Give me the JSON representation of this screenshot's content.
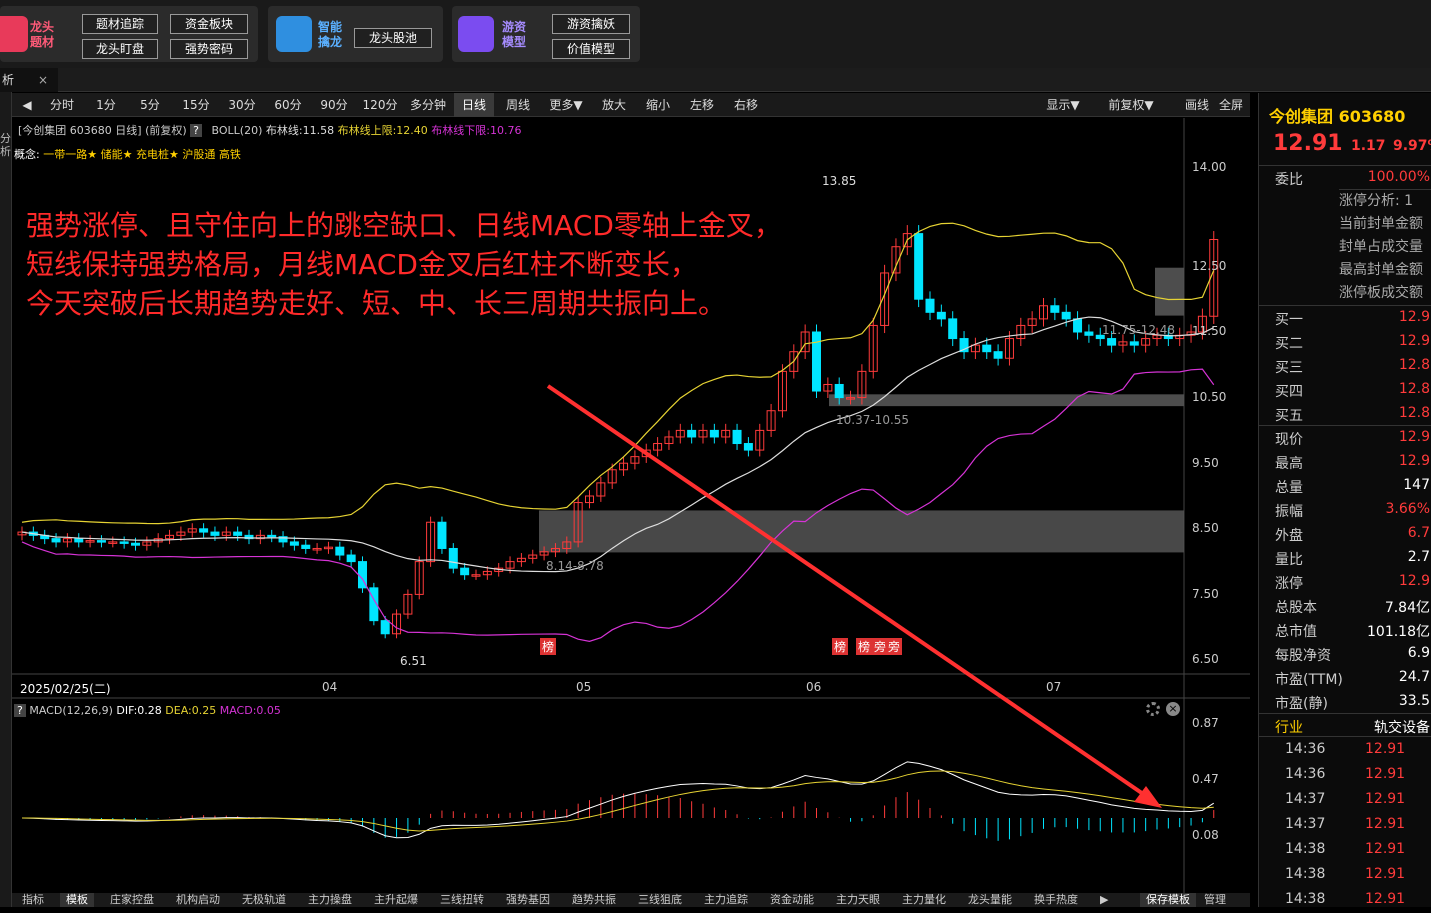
{
  "topbar": {
    "g1": {
      "title1": "龙头",
      "title2": "题材",
      "buttons": [
        "题材追踪",
        "资金板块",
        "龙头盯盘",
        "强势密码"
      ]
    },
    "g2": {
      "title1": "智能",
      "title2": "擒龙",
      "buttons": [
        "龙头股池"
      ]
    },
    "g3": {
      "title1": "游资",
      "title2": "模型",
      "buttons": [
        "游资擒妖",
        "价值模型"
      ]
    }
  },
  "tab": {
    "label": "析",
    "close": "×"
  },
  "leftstrip_text": "分析",
  "toolbar": {
    "periods": [
      "分时",
      "1分",
      "5分",
      "15分",
      "30分",
      "60分",
      "90分",
      "120分",
      "多分钟",
      "日线",
      "周线",
      "更多▼",
      "放大",
      "缩小",
      "左移",
      "右移"
    ],
    "active": "日线",
    "right": [
      "显示▼",
      "前复权▼",
      "画线",
      "全屏"
    ]
  },
  "chart_info": {
    "stock": "[今创集团 603680 日线]",
    "adjust": "(前复权)",
    "help": "?",
    "boll": "BOLL(20)",
    "mid": "布林线:11.58",
    "upper": "布林线上限:12.40",
    "lower": "布林线下限:10.76",
    "concept_label": "概念:",
    "concepts": [
      "一带一路★",
      "储能★",
      "充电桩★",
      "沪股通",
      "高铁"
    ]
  },
  "annotation": [
    "强势涨停、且守住向上的跳空缺口、日线MACD零轴上金叉，",
    "短线保持强势格局，月线MACD金叉后红柱不断变长，",
    "今天突破后长期趋势走好、短、中、长三周期共振向上。"
  ],
  "price_labels": {
    "high": "13.85",
    "low": "6.51",
    "gap1": "10.37-10.55",
    "gap2": "8.14-8.78",
    "gap3": "11.75-12.48"
  },
  "badges": [
    "榜",
    "榜",
    "榜",
    "旁",
    "旁"
  ],
  "date": "2025/02/25(二)",
  "months": [
    "04",
    "05",
    "06",
    "07"
  ],
  "y_ticks": [
    "14.00",
    "12.50",
    "11.50",
    "10.50",
    "9.50",
    "8.50",
    "7.50",
    "6.50"
  ],
  "macd": {
    "label": "MACD(12,26,9)",
    "dif": "DIF:0.28",
    "dea": "DEA:0.25",
    "macd": "MACD:0.05",
    "ticks": [
      "0.87",
      "0.47",
      "0.08"
    ]
  },
  "bottom_tabs": [
    "指标",
    "模板",
    "庄家控盘",
    "机构启动",
    "无极轨道",
    "主力操盘",
    "主升起爆",
    "三线扭转",
    "强势基因",
    "趋势共振",
    "三线狙底",
    "主力追踪",
    "资金动能",
    "主力天眼",
    "主力量化",
    "龙头量能",
    "换手热度",
    "▶",
    "保存模板",
    "管理"
  ],
  "quote": {
    "name": "今创集团 603680",
    "price": "12.91",
    "change": "1.17",
    "pct": "9.97%",
    "weibi_label": "委比",
    "weibi": "100.00%",
    "notes": [
      "涨停分析: 1",
      "当前封单金额",
      "封单占成交量",
      "最高封单金额",
      "涨停板成交额"
    ],
    "levels": [
      {
        "label": "买一",
        "value": "12.9"
      },
      {
        "label": "买二",
        "value": "12.9"
      },
      {
        "label": "买三",
        "value": "12.8"
      },
      {
        "label": "买四",
        "value": "12.8"
      },
      {
        "label": "买五",
        "value": "12.8"
      }
    ],
    "stats": [
      {
        "label": "现价",
        "value": "12.9",
        "color": "#ff3b3b"
      },
      {
        "label": "最高",
        "value": "12.9",
        "color": "#ff3b3b"
      },
      {
        "label": "总量",
        "value": "147",
        "color": "#fff"
      },
      {
        "label": "振幅",
        "value": "3.66%",
        "color": "#ff3b3b"
      },
      {
        "label": "外盘",
        "value": "6.7",
        "color": "#ff3b3b"
      },
      {
        "label": "量比",
        "value": "2.7",
        "color": "#fff"
      },
      {
        "label": "涨停",
        "value": "12.9",
        "color": "#ff3b3b"
      },
      {
        "label": "总股本",
        "value": "7.84亿",
        "color": "#fff"
      },
      {
        "label": "总市值",
        "value": "101.18亿",
        "color": "#fff"
      },
      {
        "label": "每股净资",
        "value": "6.9",
        "color": "#fff"
      },
      {
        "label": "市盈(TTM)",
        "value": "24.7",
        "color": "#fff"
      },
      {
        "label": "市盈(静)",
        "value": "33.5",
        "color": "#fff"
      }
    ],
    "industry_label": "行业",
    "industry": "轨交设备",
    "ticks": [
      {
        "t": "14:36",
        "p": "12.91"
      },
      {
        "t": "14:36",
        "p": "12.91"
      },
      {
        "t": "14:37",
        "p": "12.91"
      },
      {
        "t": "14:37",
        "p": "12.91"
      },
      {
        "t": "14:38",
        "p": "12.91"
      },
      {
        "t": "14:38",
        "p": "12.91"
      },
      {
        "t": "14:38",
        "p": "12.91"
      }
    ]
  },
  "colors": {
    "up": "#ff3b3b",
    "down": "#00e5ff",
    "boll_upper": "#e6d333",
    "boll_mid": "#dddddd",
    "boll_lower": "#d633d6",
    "arrow": "#ff3030",
    "quote_name": "#ffd000"
  }
}
